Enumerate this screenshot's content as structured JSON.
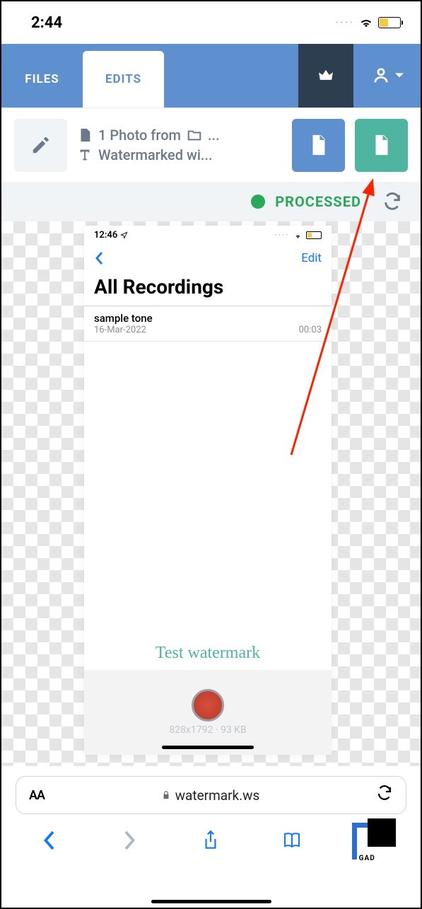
{
  "status_bar": {
    "time": "2:44"
  },
  "top_nav": {
    "tabs": [
      "FILES",
      "EDITS"
    ],
    "active_tab": 1
  },
  "edit_bar": {
    "photo_line": "1 Photo from",
    "watermark_line": "Watermarked wi..."
  },
  "status_strip": {
    "label": "PROCESSED"
  },
  "preview": {
    "inner_time": "12:46",
    "edit_label": "Edit",
    "title": "All Recordings",
    "item": {
      "name": "sample tone",
      "date": "16-Mar-2022",
      "duration": "00:03"
    },
    "watermark_text": "Test watermark",
    "meta_dims": "828x1792 · 93 KB"
  },
  "safari": {
    "url": "watermark.ws",
    "aa": "AA"
  },
  "brand_suffix": "GAD"
}
